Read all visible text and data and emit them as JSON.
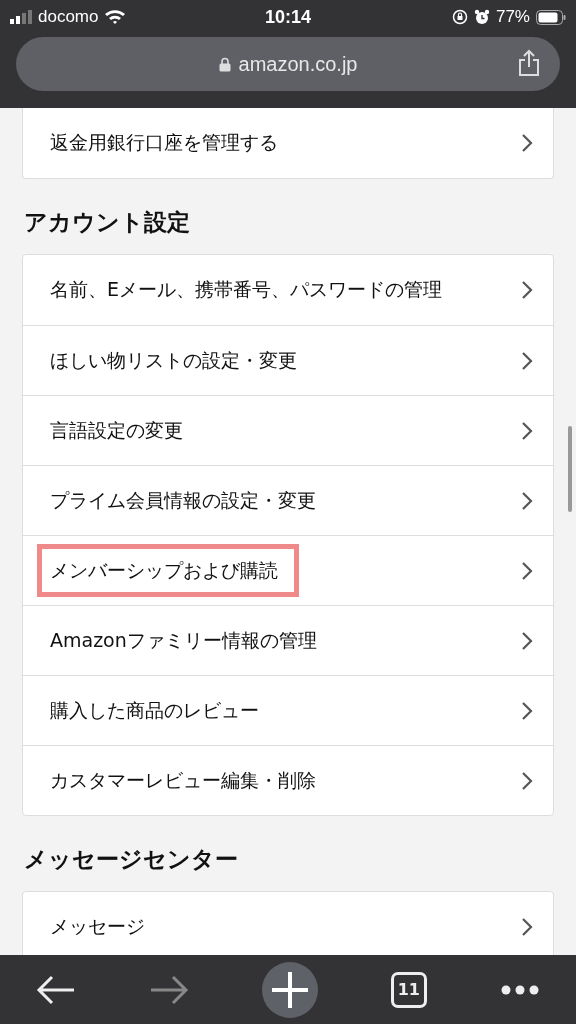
{
  "status_bar": {
    "carrier": "docomo",
    "time": "10:14",
    "battery": "77%"
  },
  "address_bar": {
    "url": "amazon.co.jp"
  },
  "sections": [
    {
      "items": [
        {
          "label": "返金用銀行口座を管理する",
          "highlighted": false
        }
      ]
    },
    {
      "title": "アカウント設定",
      "items": [
        {
          "label": "名前、Eメール、携帯番号、パスワードの管理",
          "highlighted": false
        },
        {
          "label": "ほしい物リストの設定・変更",
          "highlighted": false
        },
        {
          "label": "言語設定の変更",
          "highlighted": false
        },
        {
          "label": "プライム会員情報の設定・変更",
          "highlighted": false
        },
        {
          "label": "メンバーシップおよび購読",
          "highlighted": true
        },
        {
          "label": "Amazonファミリー情報の管理",
          "highlighted": false
        },
        {
          "label": "購入した商品のレビュー",
          "highlighted": false
        },
        {
          "label": "カスタマーレビュー編集・削除",
          "highlighted": false
        }
      ]
    },
    {
      "title": "メッセージセンター",
      "items": [
        {
          "label": "メッセージ",
          "highlighted": false
        }
      ]
    }
  ],
  "toolbar": {
    "tab_count": "11"
  }
}
